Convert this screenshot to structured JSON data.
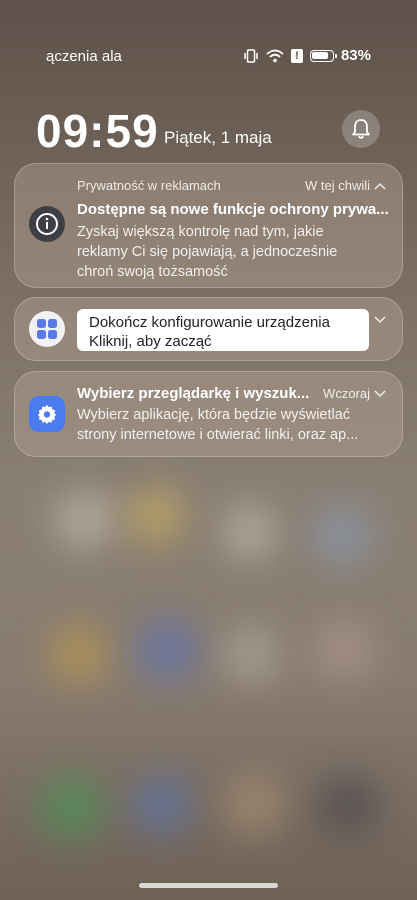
{
  "status_bar": {
    "carrier_text": "ączenia ala",
    "battery_percent": "83%",
    "battery_level": 0.83
  },
  "lockscreen": {
    "time": "09:59",
    "date": "Piątek, 1 maja"
  },
  "notifications": [
    {
      "app_label": "Prywatność w reklamach",
      "time_label": "W tej chwili",
      "title": "Dostępne są nowe funkcje ochrony prywa...",
      "body_line1": "Zyskaj większą kontrolę nad tym, jakie",
      "body_line2": "reklamy Ci się pojawiają, a jednocześnie",
      "body_line3": "chroń swoją tożsamość",
      "icon": "info-icon",
      "expanded": true
    },
    {
      "title": "Dokończ konfigurowanie urządzenia",
      "body": "Kliknij, aby zacząć",
      "icon": "apps-grid-icon",
      "expanded": false
    },
    {
      "title": "Wybierz przeglądarkę i wyszuk...",
      "time_label": "Wczoraj",
      "body_line1": "Wybierz aplikację, która będzie wyświetlać",
      "body_line2": "strony internetowe i otwierać linki, oraz ap...",
      "icon": "settings-gear-icon",
      "expanded": false
    }
  ],
  "colors": {
    "info_icon_bg": "#3d3f44",
    "apps_icon_bg": "#f2f2f4",
    "apps_icon_tiles": "#5b79e8",
    "settings_icon_bg": "#4a7cf0"
  }
}
